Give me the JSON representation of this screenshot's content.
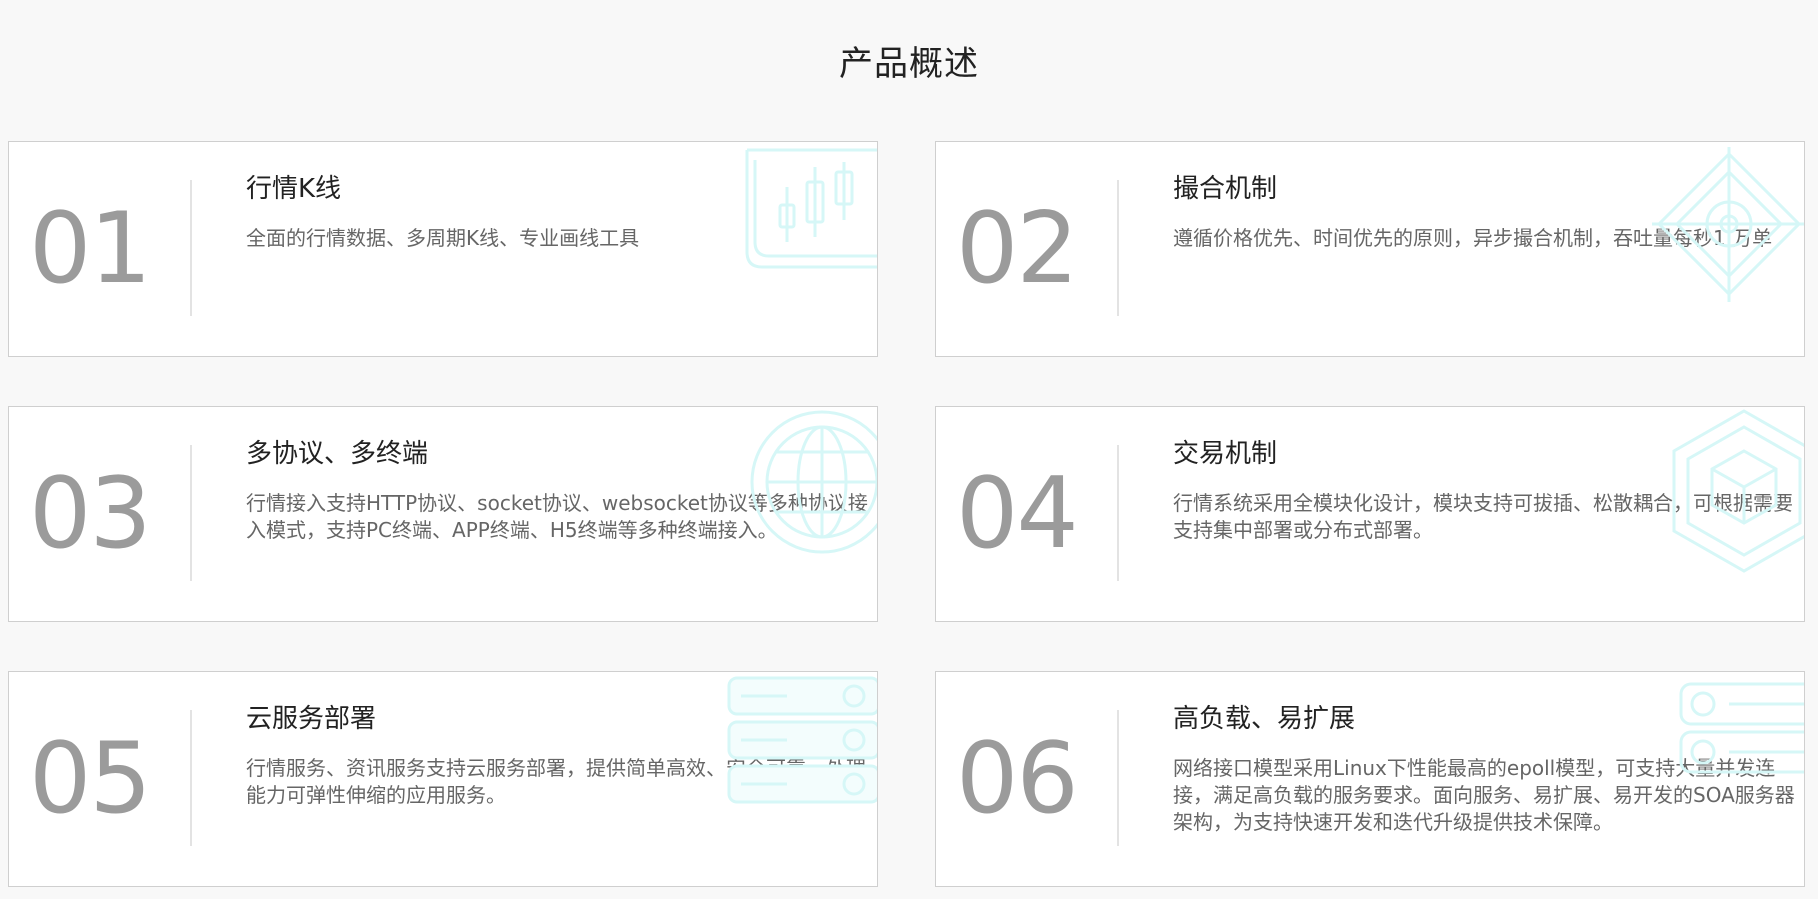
{
  "section": {
    "title": "产品概述"
  },
  "cards": [
    {
      "number": "01",
      "title": "行情K线",
      "desc": "全面的行情数据、多周期K线、专业画线工具",
      "icon": "candlestick-chart-icon"
    },
    {
      "number": "02",
      "title": "撮合机制",
      "desc": "遵循价格优先、时间优先的原则，异步撮合机制，吞吐量每秒1 万单",
      "icon": "crosshair-diamond-icon"
    },
    {
      "number": "03",
      "title": "多协议、多终端",
      "desc": "行情接入支持HTTP协议、socket协议、websocket协议等多种协议接入模式，支持PC终端、APP终端、H5终端等多种终端接入。",
      "icon": "globe-icon"
    },
    {
      "number": "04",
      "title": "交易机制",
      "desc": "行情系统采用全模块化设计，模块支持可拔插、松散耦合，可根据需要支持集中部署或分布式部署。",
      "icon": "cube-hexagon-icon"
    },
    {
      "number": "05",
      "title": "云服务部署",
      "desc": "行情服务、资讯服务支持云服务部署，提供简单高效、安全可靠、处理能力可弹性伸缩的应用服务。",
      "icon": "server-rack-icon"
    },
    {
      "number": "06",
      "title": "高负载、易扩展",
      "desc": "网络接口模型采用Linux下性能最高的epoll模型，可支持大量并发连接，满足高负载的服务要求。面向服务、易扩展、易开发的SOA服务器架构，为支持快速开发和迭代升级提供技术保障。",
      "icon": "server-toggle-icon"
    }
  ],
  "colors": {
    "background": "#f8f8f8",
    "card_border": "#cfcfcf",
    "number": "#9b9b9b",
    "deco": "#d6f7f7"
  }
}
